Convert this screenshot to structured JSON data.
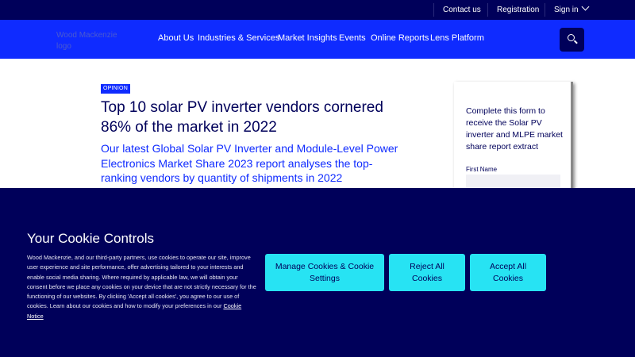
{
  "topbar": {
    "contact": "Contact us",
    "registration": "Registration",
    "signin": "Sign in"
  },
  "header": {
    "logo_alt": "Wood Mackenzie logo",
    "nav": [
      "About Us",
      "Industries & Services",
      "Market Insights",
      "Events",
      "Online Reports",
      "Lens Platform"
    ]
  },
  "article": {
    "badge": "OPINION",
    "title": "Top 10 solar PV inverter vendors cornered 86% of the market in 2022",
    "subtitle": "Our latest Global Solar PV Inverter and Module-Level Power Electronics Market Share 2023 report analyses the top-ranking vendors by quantity of shipments in 2022"
  },
  "form": {
    "intro": "Complete this form to receive the Solar PV inverter and MLPE market share report extract",
    "first_name_label": "First Name"
  },
  "cookie": {
    "title": "Your Cookie Controls",
    "text": "Wood Mackenzie, and our third-party partners, use cookies to operate our site, improve user experience and site performance, offer advertising tailored to your interests and enable social media sharing. Where required by applicable law, we will obtain your consent before we place any cookies on your device that are not strictly necessary for the functioning of our websites. By clicking 'Accept all cookies', you agree to our use of cookies. Learn about our cookies and how to modify your preferences in our ",
    "notice_link": "Cookie Notice",
    "manage_btn": "Manage Cookies & Cookie Settings",
    "reject_btn": "Reject All Cookies",
    "accept_btn": "Accept All Cookies"
  },
  "colors": {
    "navy": "#00005a",
    "brand_blue": "#0f2bff",
    "cyan": "#27e3f3"
  }
}
